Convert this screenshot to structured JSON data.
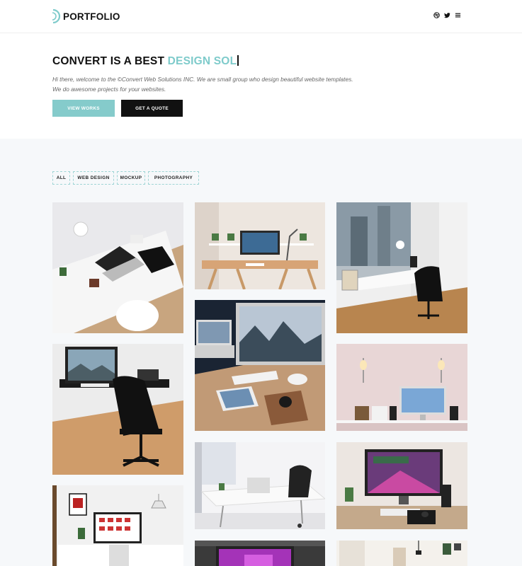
{
  "header": {
    "logo_text": "PORTFOLIO",
    "icons": [
      "dribbble-icon",
      "twitter-icon",
      "menu-icon"
    ]
  },
  "hero": {
    "title_prefix": "CONVERT IS A BEST ",
    "title_accent": "DESIGN SOL",
    "description_line1": "Hi there, welcome to the ©Convert Web Solutions INC. We are small group who design beautiful website templates.",
    "description_line2": "We do awesome projects for your websites.",
    "view_works_label": "VIEW WORKS",
    "get_quote_label": "GET A QUOTE"
  },
  "filters": [
    "ALL",
    "WEB DESIGN",
    "MOCKUP",
    "PHOTOGRAPHY"
  ],
  "colors": {
    "accent": "#7ecbcb",
    "button_accent": "#85cbcb",
    "dark": "#111111",
    "gallery_background": "#f6f8fa"
  }
}
